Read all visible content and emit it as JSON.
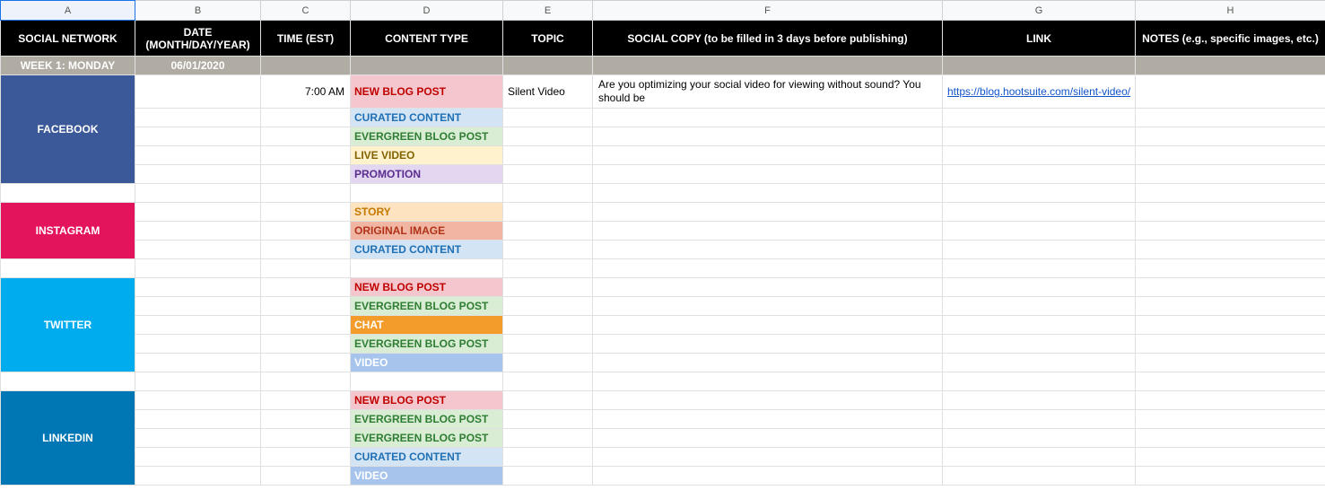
{
  "columns": {
    "A": "A",
    "B": "B",
    "C": "C",
    "D": "D",
    "E": "E",
    "F": "F",
    "G": "G",
    "H": "H"
  },
  "headers": {
    "A": "SOCIAL NETWORK",
    "B": "DATE (MONTH/DAY/YEAR)",
    "C": "TIME (EST)",
    "D": "CONTENT TYPE",
    "E": "TOPIC",
    "F": "SOCIAL COPY (to be filled in 3 days before publishing)",
    "G": "LINK",
    "H": "NOTES (e.g., specific images, etc.)"
  },
  "week": {
    "label": "WEEK 1: MONDAY",
    "date": "06/01/2020"
  },
  "networks": {
    "facebook": "FACEBOOK",
    "instagram": "INSTAGRAM",
    "twitter": "TWITTER",
    "linkedin": "LINKEDIN"
  },
  "content_types": {
    "newblog": "NEW BLOG POST",
    "curated": "CURATED CONTENT",
    "evergreen": "EVERGREEN BLOG POST",
    "live": "LIVE VIDEO",
    "promo": "PROMOTION",
    "story": "STORY",
    "origimg": "ORIGINAL IMAGE",
    "chat": "CHAT",
    "video": "VIDEO"
  },
  "row_fb1": {
    "time": "7:00 AM",
    "topic": "Silent Video",
    "copy": "Are you optimizing your social video for viewing without sound? You should be",
    "link": "https://blog.hootsuite.com/silent-video/"
  }
}
